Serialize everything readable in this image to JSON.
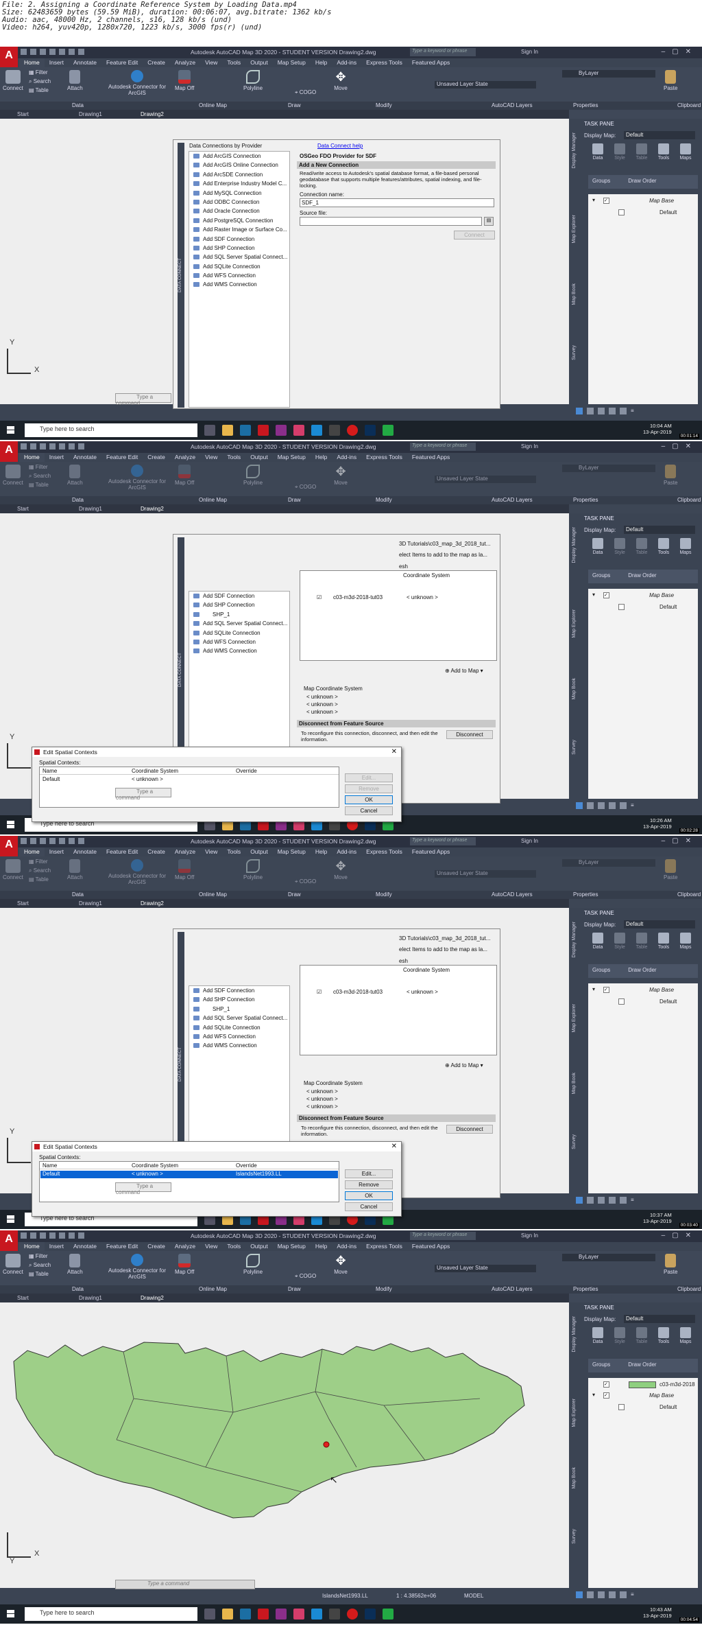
{
  "header": {
    "lines": [
      "File: 2. Assigning a Coordinate Reference System by Loading Data.mp4",
      "Size: 62483659 bytes (59.59 MiB), duration: 00:06:07, avg.bitrate: 1362 kb/s",
      "Audio: aac, 48000 Hz, 2 channels, s16, 128 kb/s (und)",
      "Video: h264, yuv420p, 1280x720, 1223 kb/s, 3000 fps(r) (und)"
    ]
  },
  "app": {
    "logo": "A",
    "title1": "Autodesk AutoCAD Map 3D 2020 - STUDENT VERSION   Drawing2.dwg",
    "search": "Type a keyword or phrase",
    "signin": "Sign In",
    "tabs": [
      "Home",
      "Insert",
      "Annotate",
      "Feature Edit",
      "Create",
      "Analyze",
      "View",
      "Tools",
      "Output",
      "Map Setup",
      "Help",
      "Add-ins",
      "Express Tools",
      "Featured Apps"
    ],
    "ribbon": {
      "connect": "Connect",
      "filter": "Filter",
      "search": "Search",
      "table": "Table",
      "attach": "Attach",
      "arcgis": "Autodesk Connector for ArcGIS",
      "mapoff": "Map Off",
      "polyline": "Polyline",
      "cogo": "COGO",
      "move": "Move",
      "layerstate": "Unsaved Layer State",
      "bylayer": "ByLayer",
      "paste": "Paste",
      "panels": [
        "Data",
        "Online Map",
        "Draw",
        "Modify",
        "AutoCAD Layers",
        "Properties",
        "Clipboard"
      ]
    },
    "doctabs": [
      "Start",
      "Drawing1",
      "Drawing2"
    ],
    "taskpane": {
      "title": "TASK PANE",
      "display_map_label": "Display Map:",
      "display_map": "Default",
      "tools": [
        "Data",
        "Style",
        "Table",
        "Tools",
        "Maps"
      ],
      "groups": "Groups",
      "draworder": "Draw Order",
      "mapbase": "Map Base",
      "default": "Default",
      "side": [
        "Display Manager",
        "Map Explorer",
        "Map Book",
        "Survey"
      ],
      "layer": "c03-m3d-2018"
    },
    "cmd": "Type a command"
  },
  "frame1": {
    "dc_title": "Data Connections by Provider",
    "dc_items": [
      "Add ArcGIS Connection",
      "Add ArcGIS Online Connection",
      "Add ArcSDE Connection",
      "Add Enterprise Industry Model C...",
      "Add MySQL Connection",
      "Add ODBC Connection",
      "Add Oracle Connection",
      "Add PostgreSQL Connection",
      "Add Raster Image or Surface Co...",
      "Add SDF Connection",
      "Add SHP Connection",
      "Add SQL Server Spatial Connect...",
      "Add SQLite Connection",
      "Add WFS Connection",
      "Add WMS Connection"
    ],
    "help": "Data Connect help",
    "provider": "OSGeo FDO Provider for SDF",
    "add_new": "Add a New Connection",
    "desc": "Read/write access to Autodesk's spatial database format, a file-based personal geodatabase that supports multiple features/attributes, spatial indexing, and file-locking.",
    "conn_name_label": "Connection name:",
    "conn_name": "SDF_1",
    "source_label": "Source file:",
    "connect_btn": "Connect",
    "vtitle": "DATA CONNECT",
    "time": "10:04 AM",
    "date": "13-Apr-2019",
    "stamp": "00:01:14"
  },
  "frame2": {
    "dlg_title": "Edit Spatial Contexts",
    "label": "Spatial Contexts:",
    "cols": [
      "Name",
      "Coordinate System",
      "Override"
    ],
    "row": {
      "name": "Default",
      "cs": "< unknown >",
      "ov": ""
    },
    "btns": [
      "Edit...",
      "Remove",
      "OK",
      "Cancel"
    ],
    "path": "3D Tutorials\\c03_map_3d_2018_tut...",
    "select_text": "elect Items to add to the map as la...",
    "mesh": "esh",
    "cs_header": "Coordinate System",
    "feature": "c03-m3d-2018-tut03",
    "unknown": "< unknown >",
    "shp": "SHP_1",
    "add_to_map": "Add to Map",
    "map_cs": "Map Coordinate System",
    "cs_vals": [
      "< unknown >",
      "< unknown >",
      "< unknown >"
    ],
    "disconnect_hdr": "Disconnect from Feature Source",
    "disconnect_text": "To reconfigure this connection, disconnect, and then edit the information.",
    "disconnect_btn": "Disconnect",
    "time": "10:26 AM",
    "date": "13-Apr-2019",
    "stamp": "00:02:28"
  },
  "frame3": {
    "override": "IslandsNet1993.LL",
    "time": "10:37 AM",
    "date": "13-Apr-2019",
    "stamp": "00:03:40"
  },
  "frame4": {
    "status_cs": "IslandsNet1993.LL",
    "scale": "1 : 4.38562e+06",
    "model": "MODEL",
    "time": "10:43 AM",
    "date": "13-Apr-2019",
    "stamp": "00:04:54"
  },
  "taskbar": {
    "search": "Type here to search"
  }
}
